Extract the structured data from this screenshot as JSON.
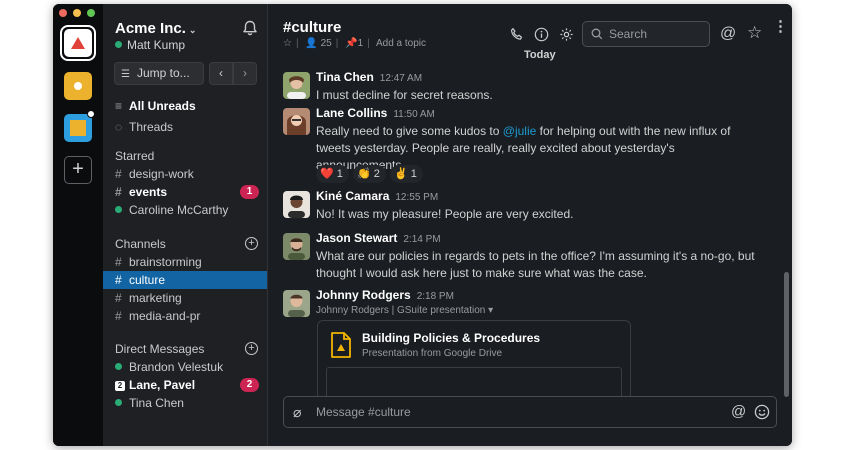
{
  "workspace": {
    "team_name": "Acme Inc.",
    "user_name": "Matt Kump",
    "jump_to": "Jump to...",
    "all_unreads": "All Unreads",
    "threads": "Threads"
  },
  "sidebar": {
    "starred_heading": "Starred",
    "starred": [
      {
        "label": "design-work"
      },
      {
        "label": "events",
        "badge": "1"
      },
      {
        "label": "Caroline McCarthy"
      }
    ],
    "channels_heading": "Channels",
    "channels": [
      {
        "label": "brainstorming"
      },
      {
        "label": "culture"
      },
      {
        "label": "marketing"
      },
      {
        "label": "media-and-pr"
      }
    ],
    "dm_heading": "Direct Messages",
    "dms": [
      {
        "label": "Brandon Velestuk"
      },
      {
        "label": "Lane, Pavel",
        "count": "2",
        "badge": "2"
      },
      {
        "label": "Tina Chen"
      }
    ]
  },
  "channel": {
    "name": "#culture",
    "members": "25",
    "pins": "1",
    "add_topic": "Add a topic",
    "search_placeholder": "Search",
    "divider": "Today"
  },
  "messages": [
    {
      "author": "Tina Chen",
      "time": "12:47 AM",
      "text": "I must decline for secret reasons."
    },
    {
      "author": "Lane Collins",
      "time": "11:50 AM",
      "text_before": "Really need to give some kudos to ",
      "mention": "@julie",
      "text_after": " for helping out with the new influx of tweets yesterday. People are really, really excited about yesterday's announcements.",
      "reactions": [
        {
          "emoji": "❤️",
          "count": "1"
        },
        {
          "emoji": "👏",
          "count": "2"
        },
        {
          "emoji": "✌️",
          "count": "1"
        }
      ]
    },
    {
      "author": "Kiné Camara",
      "time": "12:55 PM",
      "text": "No! It was my pleasure! People are very excited."
    },
    {
      "author": "Jason Stewart",
      "time": "2:14 PM",
      "text": "What are our policies in regards to pets in the office? I'm assuming it's a no-go, but thought I would ask here just to make sure what was the case."
    },
    {
      "author": "Johnny Rodgers",
      "time": "2:18 PM",
      "subtitle": "Johnny Rodgers | GSuite presentation",
      "attachment": {
        "title": "Building Policies & Procedures",
        "subtitle": "Presentation from Google Drive"
      }
    }
  ],
  "composer": {
    "placeholder": "Message #culture"
  },
  "colors": {
    "accent": "#1264a3",
    "badge": "#cd2553",
    "online": "#2bac76",
    "mention": "#1d9bd1",
    "gslides": "#f4b400"
  },
  "icons": [
    "bell-icon",
    "search-icon",
    "phone-icon",
    "info-icon",
    "gear-icon",
    "at-icon",
    "star-icon",
    "more-icon",
    "paperclip-icon",
    "emoji-icon"
  ]
}
